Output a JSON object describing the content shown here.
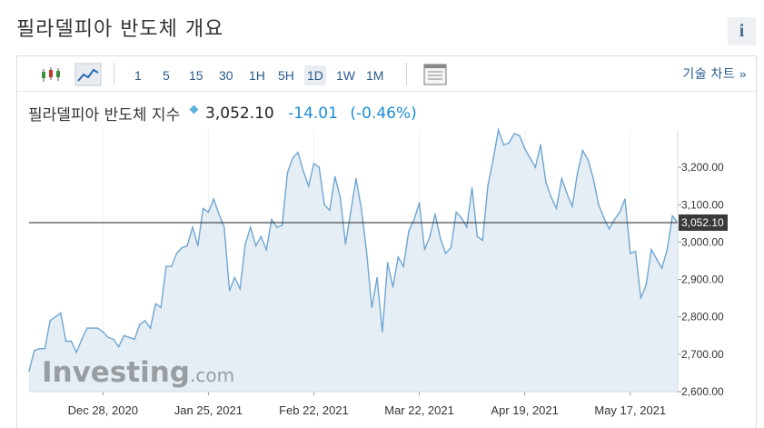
{
  "page": {
    "title": "필라델피아 반도체 개요",
    "info_label": "i"
  },
  "toolbar": {
    "icons": [
      "candlestick-chart-icon",
      "area-chart-icon",
      "table-view-icon"
    ],
    "timeframes": [
      "1",
      "5",
      "15",
      "30",
      "1H",
      "5H",
      "1D",
      "1W",
      "1M"
    ],
    "active_timeframe": "1D",
    "advanced_chart_label": "기술 차트 »"
  },
  "quote": {
    "name": "필라델피아 반도체 지수",
    "price": "3,052.10",
    "change": "-14.01",
    "change_pct": "(-0.46%)",
    "change_color": "#1b8cd6"
  },
  "watermark": {
    "brand": "Investing",
    "suffix": ".com"
  },
  "colors": {
    "line": "#6ea6d2",
    "area": "#e6eef5",
    "accent_link": "#2a5b8c",
    "price_tag_bg": "#3a3a3a"
  },
  "chart_data": {
    "type": "area",
    "ylim": [
      2600,
      3300
    ],
    "y_ticks": [
      2600,
      2700,
      2800,
      2900,
      3000,
      3100,
      3200
    ],
    "y_tick_labels": [
      "2,600.00",
      "2,700.00",
      "2,800.00",
      "2,900.00",
      "3,000.00",
      "3,100.00",
      "3,200.00"
    ],
    "x_tick_labels": [
      "Dec 28, 2020",
      "Jan 25, 2021",
      "Feb 22, 2021",
      "Mar 22, 2021",
      "Apr 19, 2021",
      "May 17, 2021"
    ],
    "x_tick_index": [
      14,
      34,
      54,
      74,
      94,
      114
    ],
    "last_price": 3052.1,
    "last_price_label": "3,052.10",
    "values": [
      2655,
      2710,
      2715,
      2715,
      2790,
      2800,
      2810,
      2735,
      2735,
      2705,
      2740,
      2770,
      2770,
      2770,
      2760,
      2745,
      2740,
      2720,
      2750,
      2745,
      2740,
      2780,
      2790,
      2770,
      2835,
      2825,
      2935,
      2935,
      2970,
      2985,
      2990,
      3040,
      2990,
      3090,
      3080,
      3115,
      3075,
      3040,
      2870,
      2905,
      2875,
      2995,
      3040,
      2990,
      3015,
      2980,
      3060,
      3040,
      3045,
      3185,
      3225,
      3240,
      3190,
      3150,
      3210,
      3200,
      3100,
      3085,
      3175,
      3120,
      2995,
      3080,
      3170,
      3090,
      2975,
      2825,
      2905,
      2760,
      2945,
      2880,
      2960,
      2935,
      3030,
      3060,
      3105,
      2980,
      3015,
      3075,
      3010,
      2970,
      2985,
      3080,
      3065,
      3040,
      3145,
      3015,
      3005,
      3150,
      3220,
      3300,
      3260,
      3265,
      3290,
      3285,
      3250,
      3225,
      3200,
      3260,
      3160,
      3120,
      3090,
      3170,
      3130,
      3095,
      3185,
      3245,
      3220,
      3170,
      3100,
      3065,
      3035,
      3060,
      3080,
      3115,
      2970,
      2975,
      2850,
      2885,
      2980,
      2955,
      2930,
      2980,
      3070,
      3052
    ]
  }
}
